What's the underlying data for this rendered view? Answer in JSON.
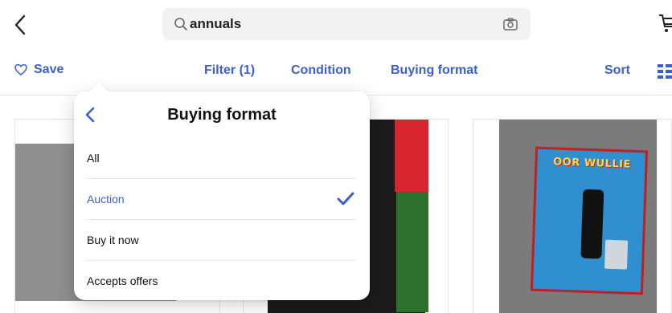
{
  "header": {
    "search_value": "annuals"
  },
  "toolbar": {
    "save_label": "Save",
    "filter_label": "Filter (1)",
    "condition_label": "Condition",
    "buying_format_label": "Buying format",
    "sort_label": "Sort"
  },
  "popover": {
    "title": "Buying format",
    "options": [
      {
        "label": "All",
        "selected": false
      },
      {
        "label": "Auction",
        "selected": true
      },
      {
        "label": "Buy it now",
        "selected": false
      },
      {
        "label": "Accepts offers",
        "selected": false
      }
    ]
  },
  "colors": {
    "accent": "#3b5fcf",
    "search_bg": "#f2f2f2"
  },
  "icons": {
    "back": "chevron-left-icon",
    "search": "search-icon",
    "camera": "camera-icon",
    "cart": "cart-icon",
    "save": "heart-icon",
    "grid": "grid-view-icon",
    "check": "checkmark-icon"
  },
  "products": [
    {
      "image": "product-image"
    },
    {
      "image": "product-image"
    },
    {
      "image": "product-image",
      "book_cover_text": "OOR WULLIE"
    }
  ]
}
